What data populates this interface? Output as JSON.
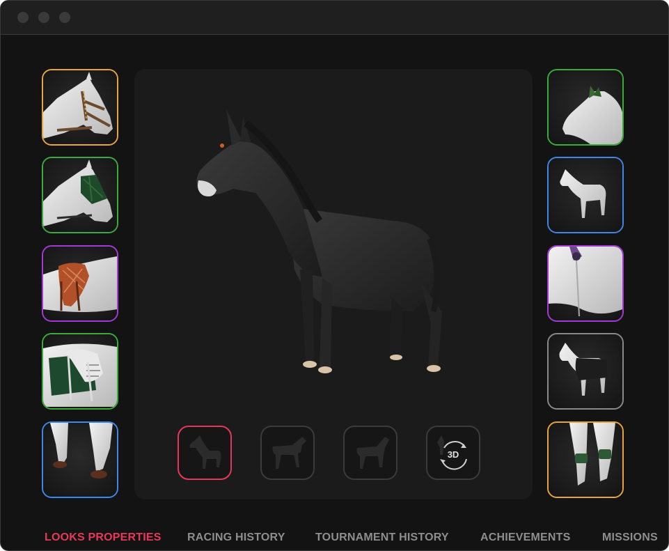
{
  "colors": {
    "background": "#131313",
    "stage": "#1b1b1b",
    "active_tab": "#e8385a",
    "inactive_tab": "#8e8e8e",
    "legendary": "#e8a53a",
    "uncommon": "#3bab3b",
    "epic": "#a43ad4",
    "rare": "#3f87e8",
    "common": "#8a8a8a"
  },
  "equipment": {
    "left": [
      {
        "item": "bridle",
        "icon": "bridle-icon",
        "rarity_color": "#e8a53a"
      },
      {
        "item": "bridle-with-fly-mask",
        "icon": "fly-mask-icon",
        "rarity_color": "#3bab3b"
      },
      {
        "item": "saddle",
        "icon": "saddle-icon",
        "rarity_color": "#a43ad4"
      },
      {
        "item": "saddle-pad",
        "icon": "saddle-pad-icon",
        "rarity_color": "#3bab3b"
      },
      {
        "item": "hooves",
        "icon": "hooves-icon",
        "rarity_color": "#3f87e8"
      }
    ],
    "right": [
      {
        "item": "ear-bonnet",
        "icon": "ear-bonnet-icon",
        "rarity_color": "#3bab3b"
      },
      {
        "item": "horse-body",
        "icon": "horse-icon",
        "rarity_color": "#3f87e8"
      },
      {
        "item": "blanket",
        "icon": "blanket-icon",
        "rarity_color": "#a43ad4"
      },
      {
        "item": "black-rug",
        "icon": "rug-icon",
        "rarity_color": "#8a8a8a"
      },
      {
        "item": "leg-boots",
        "icon": "boots-icon",
        "rarity_color": "#e8a53a"
      }
    ]
  },
  "view_buttons": [
    {
      "name": "front-view",
      "selected": true
    },
    {
      "name": "side-view",
      "selected": false
    },
    {
      "name": "rear-view",
      "selected": false
    },
    {
      "name": "rotate-3d",
      "label": "3D",
      "selected": false
    }
  ],
  "tabs": [
    {
      "label": "LOOKS PROPERTIES",
      "active": true
    },
    {
      "label": "RACING HISTORY",
      "active": false
    },
    {
      "label": "TOURNAMENT HISTORY",
      "active": false
    },
    {
      "label": "ACHIEVEMENTS",
      "active": false
    },
    {
      "label": "MISSIONS",
      "active": false
    }
  ]
}
